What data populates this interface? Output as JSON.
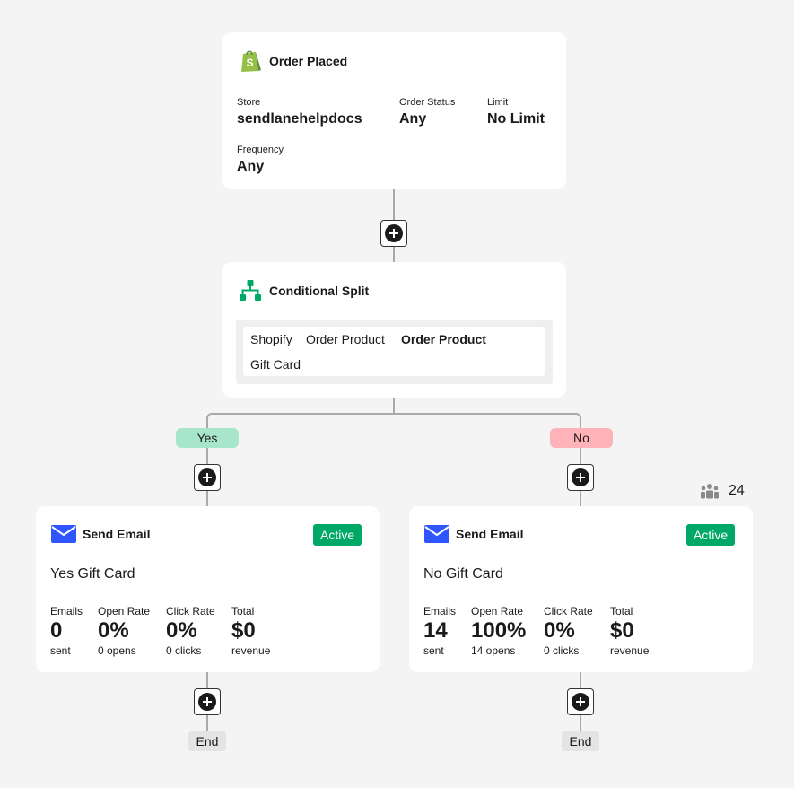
{
  "trigger": {
    "title": "Order Placed",
    "store_label": "Store",
    "store_value": "sendlanehelpdocs",
    "status_label": "Order Status",
    "status_value": "Any",
    "limit_label": "Limit",
    "limit_value": "No Limit",
    "frequency_label": "Frequency",
    "frequency_value": "Any"
  },
  "split": {
    "title": "Conditional Split",
    "condition": {
      "source": "Shopify",
      "field": "Order Product",
      "operator": "Order Product",
      "value": "Gift Card"
    },
    "yes_label": "Yes",
    "no_label": "No"
  },
  "audience": {
    "count": "24",
    "icon": "people-icon"
  },
  "emails": [
    {
      "title": "Send Email",
      "status": "Active",
      "name": "Yes Gift Card",
      "stats": [
        {
          "label": "Emails",
          "value": "0",
          "sub": "sent"
        },
        {
          "label": "Open Rate",
          "value": "0%",
          "sub": "0 opens"
        },
        {
          "label": "Click Rate",
          "value": "0%",
          "sub": "0 clicks"
        },
        {
          "label": "Total",
          "value": "$0",
          "sub": "revenue"
        }
      ],
      "end_label": "End"
    },
    {
      "title": "Send Email",
      "status": "Active",
      "name": "No Gift Card",
      "stats": [
        {
          "label": "Emails",
          "value": "14",
          "sub": "sent"
        },
        {
          "label": "Open Rate",
          "value": "100%",
          "sub": "14 opens"
        },
        {
          "label": "Click Rate",
          "value": "0%",
          "sub": "0 clicks"
        },
        {
          "label": "Total",
          "value": "$0",
          "sub": "revenue"
        }
      ],
      "end_label": "End"
    }
  ],
  "colors": {
    "background": "#f4f4f4",
    "active_green": "#00a865",
    "yes_pill": "#a8e6cc",
    "no_pill": "#ffb3b8",
    "email_blue": "#2f55ff",
    "split_green": "#00a865",
    "shopify_green": "#95bf47"
  }
}
